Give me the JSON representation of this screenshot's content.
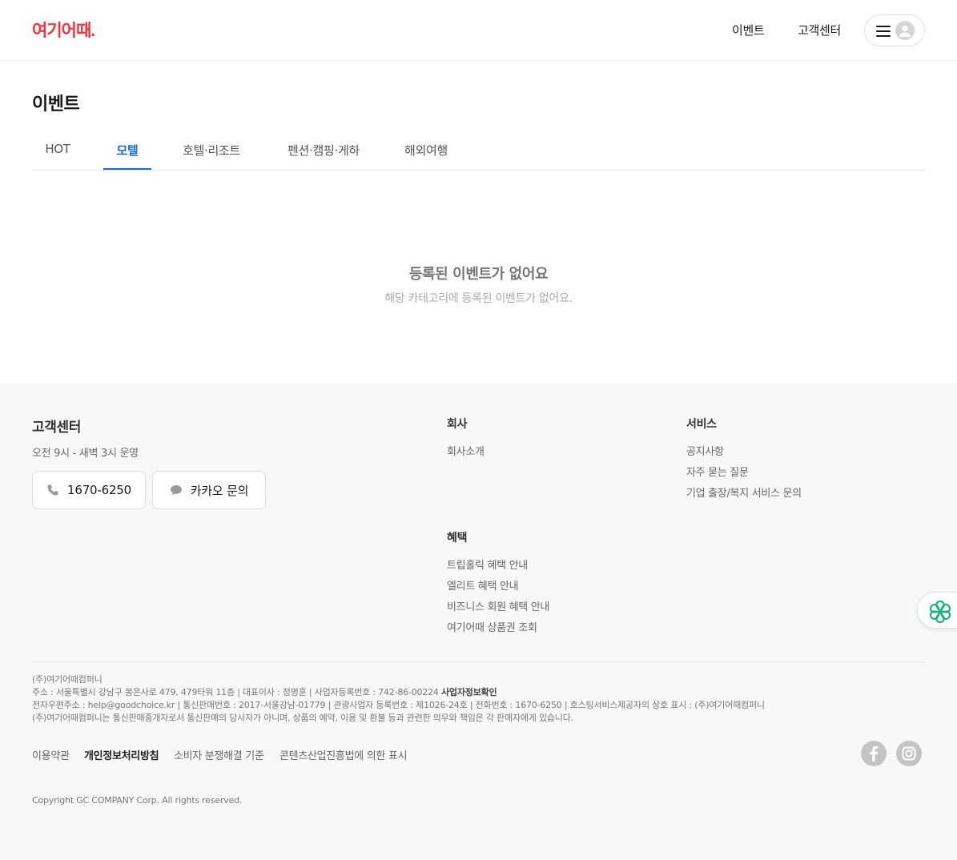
{
  "header": {
    "logo_text": "여기어때.",
    "nav": {
      "events": "이벤트",
      "customer_center": "고객센터"
    }
  },
  "page": {
    "title": "이벤트",
    "tabs": [
      {
        "label": "HOT",
        "active": false
      },
      {
        "label": "모텔",
        "active": true
      },
      {
        "label": "호텔·리조트",
        "active": false
      },
      {
        "label": "펜션·캠핑·게하",
        "active": false
      },
      {
        "label": "해외여행",
        "active": false
      }
    ],
    "empty": {
      "title": "등록된 이벤트가 없어요",
      "description": "해당 카테고리에 등록된 이벤트가 없어요."
    }
  },
  "footer": {
    "customer_center": {
      "title": "고객센터",
      "hours": "오전 9시 - 새벽 3시 운영",
      "phone": "1670-6250",
      "kakao": "카카오 문의"
    },
    "company": {
      "title": "회사",
      "links": [
        "회사소개"
      ]
    },
    "service": {
      "title": "서비스",
      "links": [
        "공지사항",
        "자주 묻는 질문",
        "기업 출장/복지 서비스 문의"
      ]
    },
    "benefits": {
      "title": "혜택",
      "links": [
        "트립홀릭 혜택 안내",
        "엘리트 혜택 안내",
        "비즈니스 회원 혜택 안내",
        "여기어때 상품권 조회"
      ]
    },
    "business_info": {
      "line1": "(주)여기어때컴퍼니",
      "line2": "주소 : 서울특별시 강남구 봉은사로 479, 479타워 11층 | 대표이사 : 정명훈 | 사업자등록번호 : 742-86-00224 ",
      "line2_link": "사업자정보확인",
      "line3": "전자우편주소 : help@goodchoice.kr | 통신판매번호 : 2017-서울강남-01779 | 관광사업자 등록번호 : 제1026-24호 | 전화번호 : 1670-6250 | 호스팅서비스제공자의 상호 표시 : (주)여기어때컴퍼니",
      "line4": "(주)여기어때컴퍼니는 통신판매중개자로서 통신판매의 당사자가 아니며, 상품의 예약, 이용 및 환불 등과 관련한 의무와 책임은 각 판매자에게 있습니다."
    },
    "legal": [
      "이용약관",
      "개인정보처리방침",
      "소비자 분쟁해결 기준",
      "콘텐츠산업진흥법에 의한 표시"
    ],
    "copyright": "Copyright GC COMPANY Corp. All rights reserved."
  },
  "icons": {
    "logo": "yeogi-logo",
    "menu": "hamburger-menu-icon",
    "user": "user-avatar-icon",
    "phone": "phone-icon",
    "kakao": "chat-bubble-icon",
    "facebook": "facebook-icon",
    "instagram": "instagram-icon",
    "floating": "ai-assistant-icon"
  },
  "colors": {
    "brand": "#f7323f",
    "active_tab": "#1a6be4",
    "footer_bg": "#f8f8f8",
    "floating_icon": "#1bb37a"
  }
}
